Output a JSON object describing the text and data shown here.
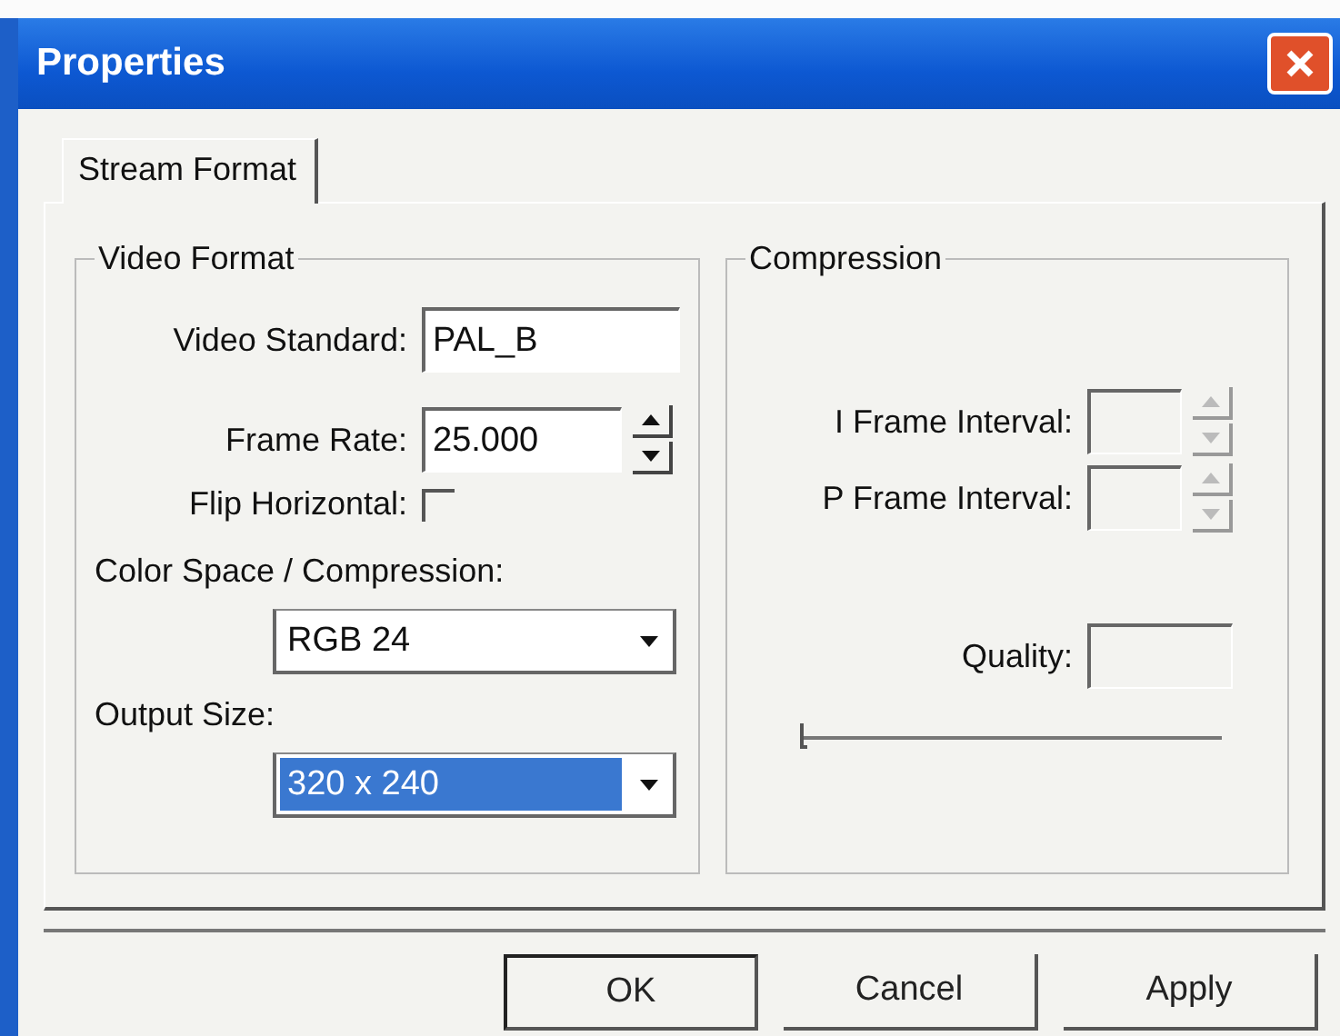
{
  "window": {
    "title": "Properties"
  },
  "tabs": [
    {
      "label": "Stream Format",
      "selected": true
    }
  ],
  "video_format": {
    "title": "Video Format",
    "video_standard": {
      "label": "Video Standard:",
      "value": "PAL_B"
    },
    "frame_rate": {
      "label": "Frame Rate:",
      "value": "25.000",
      "disabled": false
    },
    "flip_horizontal": {
      "label": "Flip Horizontal:",
      "checked": false
    },
    "color_space": {
      "label": "Color Space / Compression:",
      "value": "RGB 24",
      "focused": false
    },
    "output_size": {
      "label": "Output Size:",
      "value": "320 x 240",
      "focused": true
    }
  },
  "compression": {
    "title": "Compression",
    "i_frame_interval": {
      "label": "I Frame Interval:",
      "disabled": true
    },
    "p_frame_interval": {
      "label": "P Frame Interval:",
      "disabled": true
    },
    "quality": {
      "label": "Quality:",
      "level": 0
    }
  },
  "buttons": [
    {
      "label": "OK",
      "default": true
    },
    {
      "label": "Cancel",
      "default": false
    },
    {
      "label": "Apply",
      "default": false
    }
  ]
}
